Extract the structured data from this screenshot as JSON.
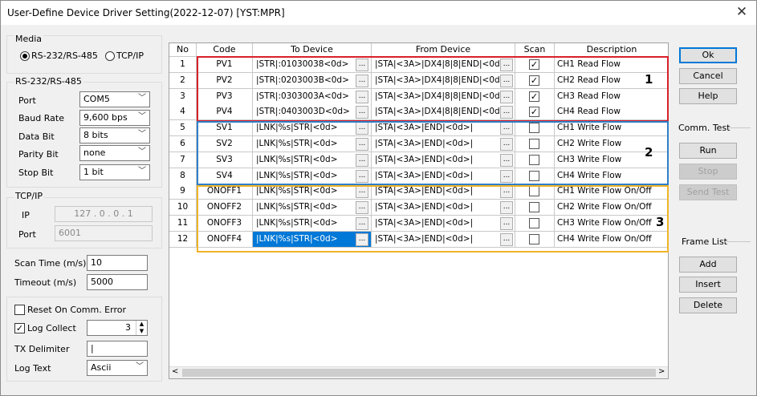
{
  "window": {
    "title": "User-Define Device Driver Setting(2022-12-07) [YST:MPR]",
    "close_glyph": "✕"
  },
  "media": {
    "title": "Media",
    "opt1": "RS-232/RS-485",
    "opt2": "TCP/IP",
    "selected": "RS-232/RS-485"
  },
  "serial": {
    "title": "RS-232/RS-485",
    "port_label": "Port",
    "port": "COM5",
    "baud_label": "Baud Rate",
    "baud": "9,600 bps",
    "databit_label": "Data Bit",
    "databit": "8 bits",
    "parity_label": "Parity Bit",
    "parity": "none",
    "stopbit_label": "Stop Bit",
    "stopbit": "1 bit"
  },
  "tcp": {
    "title": "TCP/IP",
    "ip_label": "IP",
    "ip": "127 . 0 . 0 . 1",
    "port_label": "Port",
    "port": "6001"
  },
  "timing": {
    "scan_label": "Scan Time (m/s)",
    "scan": "10",
    "timeout_label": "Timeout (m/s)",
    "timeout": "5000"
  },
  "options": {
    "reset_label": "Reset On Comm. Error",
    "reset_checked": false,
    "log_label": "Log Collect",
    "log_checked": true,
    "log_value": "3",
    "txdelim_label": "TX Delimiter",
    "txdelim": "|",
    "logtext_label": "Log Text",
    "logtext": "Ascii"
  },
  "table": {
    "headers": [
      "No",
      "Code",
      "To Device",
      "From Device",
      "Scan",
      "Description"
    ],
    "ellipsis": "...",
    "rows": [
      {
        "no": "1",
        "code": "PV1",
        "to": "|STR|:01030038<0d>",
        "from": "|STA|<3A>|DX4|8|8|END|<0d>|",
        "scan": true,
        "desc": "CH1 Read Flow"
      },
      {
        "no": "2",
        "code": "PV2",
        "to": "|STR|:0203003B<0d>",
        "from": "|STA|<3A>|DX4|8|8|END|<0d>|",
        "scan": true,
        "desc": "CH2 Read Flow"
      },
      {
        "no": "3",
        "code": "PV3",
        "to": "|STR|:0303003A<0d>",
        "from": "|STA|<3A>|DX4|8|8|END|<0d>|",
        "scan": true,
        "desc": "CH3 Read Flow"
      },
      {
        "no": "4",
        "code": "PV4",
        "to": "|STR|:0403003D<0d>",
        "from": "|STA|<3A>|DX4|8|8|END|<0d>|",
        "scan": true,
        "desc": "CH4 Read Flow"
      },
      {
        "no": "5",
        "code": "SV1",
        "to": "|LNK|%s|STR|<0d>",
        "from": "|STA|<3A>|END|<0d>|",
        "scan": false,
        "desc": "CH1 Write Flow"
      },
      {
        "no": "6",
        "code": "SV2",
        "to": "|LNK|%s|STR|<0d>",
        "from": "|STA|<3A>|END|<0d>|",
        "scan": false,
        "desc": "CH2 Write Flow"
      },
      {
        "no": "7",
        "code": "SV3",
        "to": "|LNK|%s|STR|<0d>",
        "from": "|STA|<3A>|END|<0d>|",
        "scan": false,
        "desc": "CH3 Write Flow"
      },
      {
        "no": "8",
        "code": "SV4",
        "to": "|LNK|%s|STR|<0d>",
        "from": "|STA|<3A>|END|<0d>|",
        "scan": false,
        "desc": "CH4 Write Flow"
      },
      {
        "no": "9",
        "code": "ONOFF1",
        "to": "|LNK|%s|STR|<0d>",
        "from": "|STA|<3A>|END|<0d>|",
        "scan": false,
        "desc": "CH1 Write Flow On/Off"
      },
      {
        "no": "10",
        "code": "ONOFF2",
        "to": "|LNK|%s|STR|<0d>",
        "from": "|STA|<3A>|END|<0d>|",
        "scan": false,
        "desc": "CH2 Write Flow On/Off"
      },
      {
        "no": "11",
        "code": "ONOFF3",
        "to": "|LNK|%s|STR|<0d>",
        "from": "|STA|<3A>|END|<0d>|",
        "scan": false,
        "desc": "CH3 Write Flow On/Off"
      },
      {
        "no": "12",
        "code": "ONOFF4",
        "to": "|LNK|%s|STR|<0d>",
        "from": "|STA|<3A>|END|<0d>|",
        "scan": false,
        "desc": "CH4 Write Flow On/Off"
      }
    ]
  },
  "annotations": [
    {
      "label": "1",
      "color": "#d9202a"
    },
    {
      "label": "2",
      "color": "#2f7fc8"
    },
    {
      "label": "3",
      "color": "#f0b429"
    }
  ],
  "buttons": {
    "ok": "Ok",
    "cancel": "Cancel",
    "help": "Help",
    "comm_title": "Comm. Test",
    "run": "Run",
    "stop": "Stop",
    "send": "Send Test",
    "frame_title": "Frame List",
    "add": "Add",
    "insert": "Insert",
    "delete": "Delete"
  },
  "scroll": {
    "left": "<",
    "right": ">"
  },
  "accent": "#0078d7"
}
